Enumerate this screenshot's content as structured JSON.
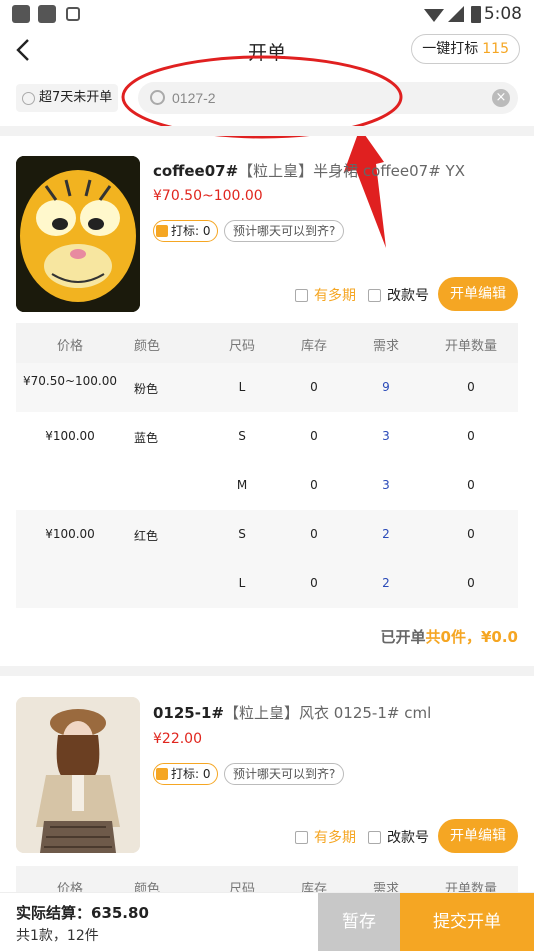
{
  "status_bar": {
    "time": "5:08"
  },
  "header": {
    "title": "开单",
    "tag_button_label": "一键打标",
    "tag_count": "115"
  },
  "filter": {
    "overdue_label": "超7天未开单",
    "search_value": "0127-2"
  },
  "products": [
    {
      "code": "coffee07#",
      "desc": "【粒上皇】半身裙 coffee07# YX",
      "price": "¥70.50~100.00",
      "tag_label": "打标: 0",
      "eta_label": "预计哪天可以到齐?",
      "multi_label": "有多期",
      "change_label": "改款号",
      "edit_label": "开单编辑",
      "rows": [
        {
          "price": "¥70.50~100.00",
          "color": "粉色",
          "size": "L",
          "stock": "0",
          "need": "9",
          "qty": "0"
        },
        {
          "price": "¥100.00",
          "color": "蓝色",
          "size": "S",
          "stock": "0",
          "need": "3",
          "qty": "0"
        },
        {
          "price": "",
          "color": "",
          "size": "M",
          "stock": "0",
          "need": "3",
          "qty": "0"
        },
        {
          "price": "¥100.00",
          "color": "红色",
          "size": "S",
          "stock": "0",
          "need": "2",
          "qty": "0"
        },
        {
          "price": "",
          "color": "",
          "size": "L",
          "stock": "0",
          "need": "2",
          "qty": "0"
        }
      ],
      "summary_prefix": "已开单",
      "summary_highlight": "共0件，¥0.0"
    },
    {
      "code": "0125-1#",
      "desc": "【粒上皇】风衣 0125-1# cml",
      "price": "¥22.00",
      "tag_label": "打标: 0",
      "eta_label": "预计哪天可以到齐?",
      "multi_label": "有多期",
      "change_label": "改款号",
      "edit_label": "开单编辑"
    }
  ],
  "table_headers": {
    "price": "价格",
    "color": "颜色",
    "size": "尺码",
    "stock": "库存",
    "need": "需求",
    "qty": "开单数量"
  },
  "bottom": {
    "total_label": "实际结算：635.80",
    "count_label": "共1款，12件",
    "save_label": "暂存",
    "submit_label": "提交开单"
  },
  "colors": {
    "accent": "#f5a623",
    "price_red": "#e0261e",
    "need_blue": "#2a4ab8",
    "annotation_red": "#e02020"
  }
}
